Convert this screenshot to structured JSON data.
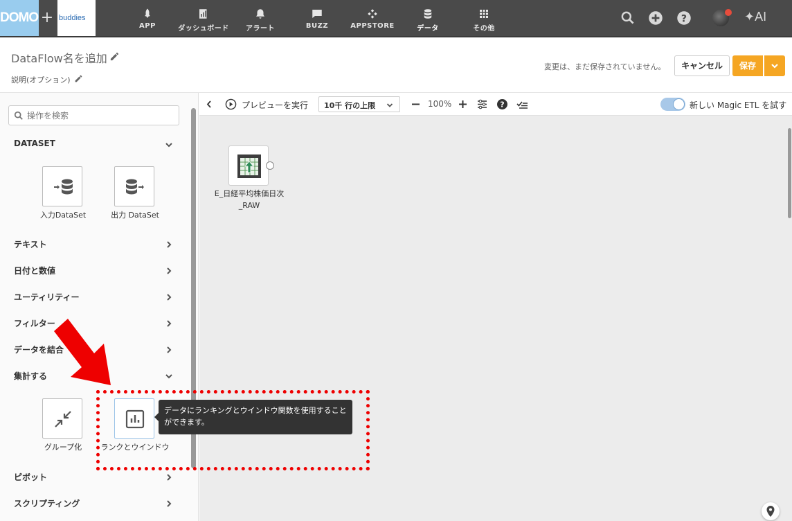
{
  "topnav": {
    "logo_text": "DOMO",
    "plus": "+",
    "buddies_text": "buddies",
    "items": [
      {
        "label": "APP",
        "icon": "rocket-icon"
      },
      {
        "label": "ダッシュボード",
        "icon": "dashboard-icon"
      },
      {
        "label": "アラート",
        "icon": "bell-icon"
      },
      {
        "label": "BUZZ",
        "icon": "chat-icon"
      },
      {
        "label": "APPSTORE",
        "icon": "appstore-icon"
      },
      {
        "label": "データ",
        "icon": "database-icon",
        "active": true
      },
      {
        "label": "その他",
        "icon": "grid-icon"
      }
    ],
    "ai_label": "AI"
  },
  "header": {
    "title": "DataFlow名を追加",
    "description": "説明(オプション)",
    "unsaved_msg": "変更は、まだ保存されていません。",
    "cancel_label": "キャンセル",
    "save_label": "保存"
  },
  "sidebar": {
    "search_placeholder": "操作を検索",
    "dataset_header": "DATASET",
    "input_tile_label": "入力DataSet",
    "output_tile_label": "出力 DataSet",
    "categories": {
      "text": "テキスト",
      "date_number": "日付と数値",
      "utility": "ユーティリティー",
      "filter": "フィルター",
      "join": "データを結合",
      "aggregate": "集計する",
      "pivot": "ピボット",
      "scripting": "スクリプティング"
    },
    "group_tile_label": "グループ化",
    "rank_tile_label": "ランクとウインドウ"
  },
  "toolbar": {
    "preview_label": "プレビューを実行",
    "row_limit": "10千 行の上限",
    "zoom": "100%",
    "magic_etl_label": "新しい Magic ETL を試す"
  },
  "canvas": {
    "node_label": "E_日経平均株価日次_RAW"
  },
  "tooltip": {
    "text": "データにランキングとウインドウ関数を使用することができます。"
  },
  "colors": {
    "nav_bg": "#4a4a4a",
    "save_orange": "#f5a623",
    "annotation_red": "#ee0000",
    "logo_blue": "#99ccee"
  }
}
